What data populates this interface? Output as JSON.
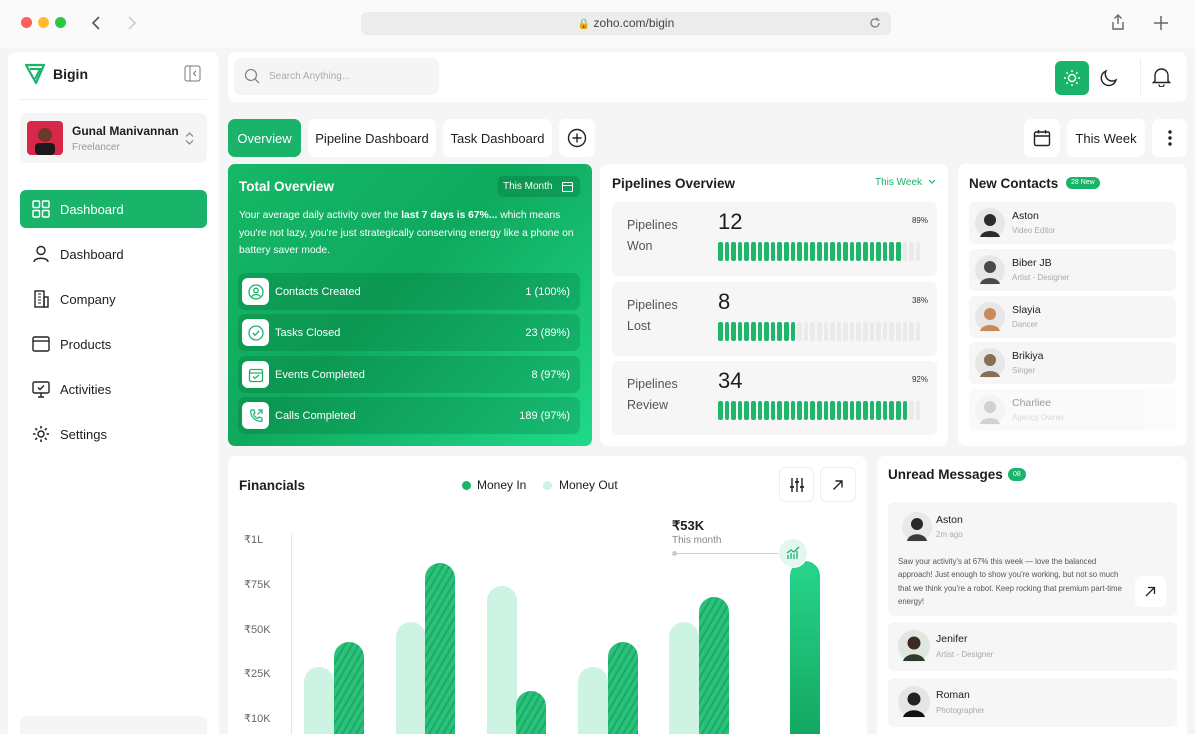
{
  "browser": {
    "url": "zoho.com/bigin"
  },
  "app": {
    "name": "Bigin"
  },
  "search": {
    "placeholder": "Search Anything..."
  },
  "user": {
    "name": "Gunal Manivannan",
    "role": "Freelancer"
  },
  "sidebar": {
    "items": [
      {
        "label": "Dashboard",
        "active": true
      },
      {
        "label": "Dashboard"
      },
      {
        "label": "Company"
      },
      {
        "label": "Products"
      },
      {
        "label": "Activities"
      },
      {
        "label": "Settings"
      }
    ]
  },
  "tabs": {
    "overview": "Overview",
    "pipeline": "Pipeline Dashboard",
    "task": "Task Dashboard",
    "period": "This Week"
  },
  "total_overview": {
    "title": "Total Overview",
    "period": "This Month",
    "desc_a": "Your average daily activity over the",
    "desc_b": "last 7 days is 67%...",
    "desc_c": "which means you're not lazy, you're just strategically conserving energy like a phone on battery saver mode.",
    "stats": [
      {
        "label": "Contacts Created",
        "value": "1 (100%)"
      },
      {
        "label": "Tasks Closed",
        "value": "23 (89%)"
      },
      {
        "label": "Events Completed",
        "value": "8 (97%)"
      },
      {
        "label": "Calls Completed",
        "value": "189 (97%)"
      }
    ]
  },
  "pipelines": {
    "title": "Pipelines Overview",
    "period": "This Week",
    "rows": [
      {
        "l1": "Pipelines",
        "l2": "Won",
        "value": "12",
        "pct": "89%",
        "fill": 0.89
      },
      {
        "l1": "Pipelines",
        "l2": "Lost",
        "value": "8",
        "pct": "38%",
        "fill": 0.38
      },
      {
        "l1": "Pipelines",
        "l2": "Review",
        "value": "34",
        "pct": "92%",
        "fill": 0.92
      }
    ]
  },
  "contacts": {
    "title": "New Contacts",
    "badge": "28 New",
    "items": [
      {
        "name": "Aston",
        "role": "Video Editor"
      },
      {
        "name": "Biber JB",
        "role": "Artist - Designer"
      },
      {
        "name": "Slayia",
        "role": "Dancer"
      },
      {
        "name": "Brikiya",
        "role": "Singer"
      },
      {
        "name": "Charliee",
        "role": "Agency Owner"
      }
    ]
  },
  "financials": {
    "title": "Financials",
    "legend_in": "Money In",
    "legend_out": "Money Out",
    "tooltip_value": "₹53K",
    "tooltip_label": "This month",
    "ticks": [
      "₹1L",
      "₹75K",
      "₹50K",
      "₹25K",
      "₹10K"
    ]
  },
  "chart_data": {
    "type": "bar",
    "ylabel": "",
    "y_ticks": [
      "₹1L",
      "₹75K",
      "₹50K",
      "₹25K",
      "₹10K"
    ],
    "series": [
      {
        "name": "Money In",
        "values": [
          40000,
          84000,
          13000,
          40000,
          65000,
          85000
        ]
      },
      {
        "name": "Money Out",
        "values": [
          15000,
          40000,
          60000,
          15000,
          40000
        ]
      }
    ],
    "annotation": {
      "value": "₹53K",
      "label": "This month"
    }
  },
  "messages": {
    "title": "Unread Messages",
    "badge": "08",
    "items": [
      {
        "name": "Aston",
        "time": "2m ago",
        "text": "Saw your activity's at 67% this week — love the balanced approach! Just enough to show you're working, but not so much that we think you're a robot. Keep rocking that premium part-time energy!"
      },
      {
        "name": "Jenifer",
        "time": "Artist - Designer"
      },
      {
        "name": "Roman",
        "time": "Photographer"
      }
    ]
  },
  "colors": {
    "accent": "#19b36a",
    "accent_light": "#cdf3e2"
  }
}
